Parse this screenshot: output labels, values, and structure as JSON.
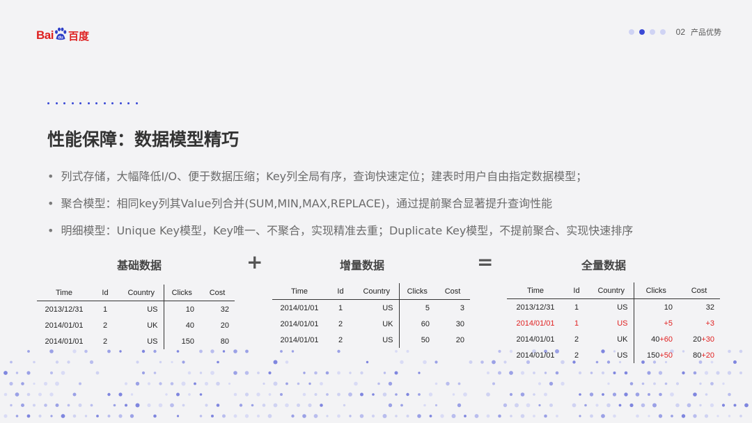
{
  "logo": {
    "bai": "Bai",
    "du": "du",
    "cn": "百度"
  },
  "pager": {
    "number": "02",
    "section": "产品优势"
  },
  "title": "性能保障：数据模型精巧",
  "bullets": [
    "列式存储，大幅降低I/O、便于数据压缩；Key列全局有序，查询快速定位；建表时用户自由指定数据模型；",
    "聚合模型：相同key列其Value列合并(SUM,MIN,MAX,REPLACE)，通过提前聚合显著提升查询性能",
    "明细模型：Unique Key模型，Key唯一、不聚合，实现精准去重；Duplicate Key模型，不提前聚合、实现快速排序"
  ],
  "operators": {
    "plus": "+",
    "equals": "="
  },
  "table_headers": {
    "time": "Time",
    "id": "Id",
    "country": "Country",
    "clicks": "Clicks",
    "cost": "Cost"
  },
  "tables": [
    {
      "caption": "基础数据",
      "rows": [
        {
          "time": "2013/12/31",
          "id": "1",
          "country": "US",
          "clicks": "10",
          "cost": "32"
        },
        {
          "time": "2014/01/01",
          "id": "2",
          "country": "UK",
          "clicks": "40",
          "cost": "20"
        },
        {
          "time": "2014/01/01",
          "id": "2",
          "country": "US",
          "clicks": "150",
          "cost": "80"
        }
      ]
    },
    {
      "caption": "增量数据",
      "rows": [
        {
          "time": "2014/01/01",
          "id": "1",
          "country": "US",
          "clicks": "5",
          "cost": "3"
        },
        {
          "time": "2014/01/01",
          "id": "2",
          "country": "UK",
          "clicks": "60",
          "cost": "30"
        },
        {
          "time": "2014/01/01",
          "id": "2",
          "country": "US",
          "clicks": "50",
          "cost": "20"
        }
      ]
    },
    {
      "caption": "全量数据",
      "rows": [
        {
          "time": "2013/12/31",
          "id": "1",
          "country": "US",
          "clicks_base": "10",
          "clicks_add": "",
          "cost_base": "32",
          "cost_add": ""
        },
        {
          "time": "2014/01/01",
          "id": "1",
          "country": "US",
          "clicks_base": "",
          "clicks_add": "+5",
          "cost_base": "",
          "cost_add": "+3"
        },
        {
          "time": "2014/01/01",
          "id": "2",
          "country": "UK",
          "clicks_base": "40",
          "clicks_add": "+60",
          "cost_base": "20",
          "cost_add": "+30"
        },
        {
          "time": "2014/01/01",
          "id": "2",
          "country": "US",
          "clicks_base": "150",
          "clicks_add": "+50",
          "cost_base": "80",
          "cost_add": "+20"
        }
      ]
    }
  ],
  "colors": {
    "accent": "#3a49d6",
    "highlight": "#e02020",
    "brand_red": "#de2121"
  },
  "icons": {
    "logo_paw": "paw-icon"
  }
}
